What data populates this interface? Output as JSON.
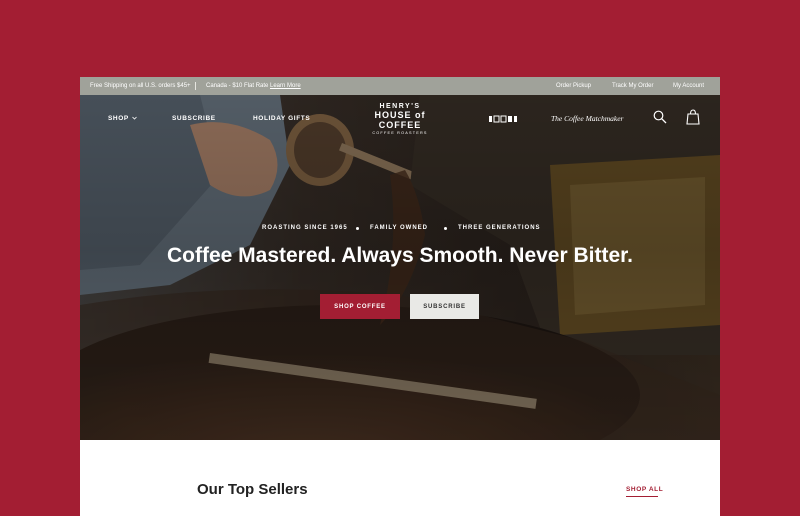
{
  "topbar": {
    "promo_us": "Free Shipping on all U.S. orders $45+",
    "promo_canada": "Canada - $10 Flat Rate",
    "learn_more": "Learn More",
    "order_pickup": "Order Pickup",
    "track_order": "Track My Order",
    "my_account": "My Account"
  },
  "nav": {
    "shop": "SHOP",
    "subscribe": "SUBSCRIBE",
    "holiday_gifts": "HOLIDAY GIFTS",
    "coffee_matchmaker": "The Coffee Matchmaker",
    "icons": [
      "search-icon",
      "shopping-bag-icon",
      "chevron-down-icon"
    ]
  },
  "logo": {
    "line1": "HENRY'S",
    "line2": "HOUSE of COFFEE",
    "line3": "COFFEE ROASTERS"
  },
  "hero": {
    "kicker": [
      "ROASTING SINCE 1965",
      "FAMILY OWNED",
      "THREE GENERATIONS"
    ],
    "headline": "Coffee Mastered. Always Smooth. Never Bitter.",
    "primary_cta": "SHOP COFFEE",
    "secondary_cta": "SUBSCRIBE"
  },
  "top_sellers": {
    "title": "Our Top Sellers",
    "shop_all": "SHOP ALL"
  },
  "colors": {
    "brand": "#a31e33",
    "topbar": "#a0a29a",
    "hero_dark": "#2a211c"
  }
}
